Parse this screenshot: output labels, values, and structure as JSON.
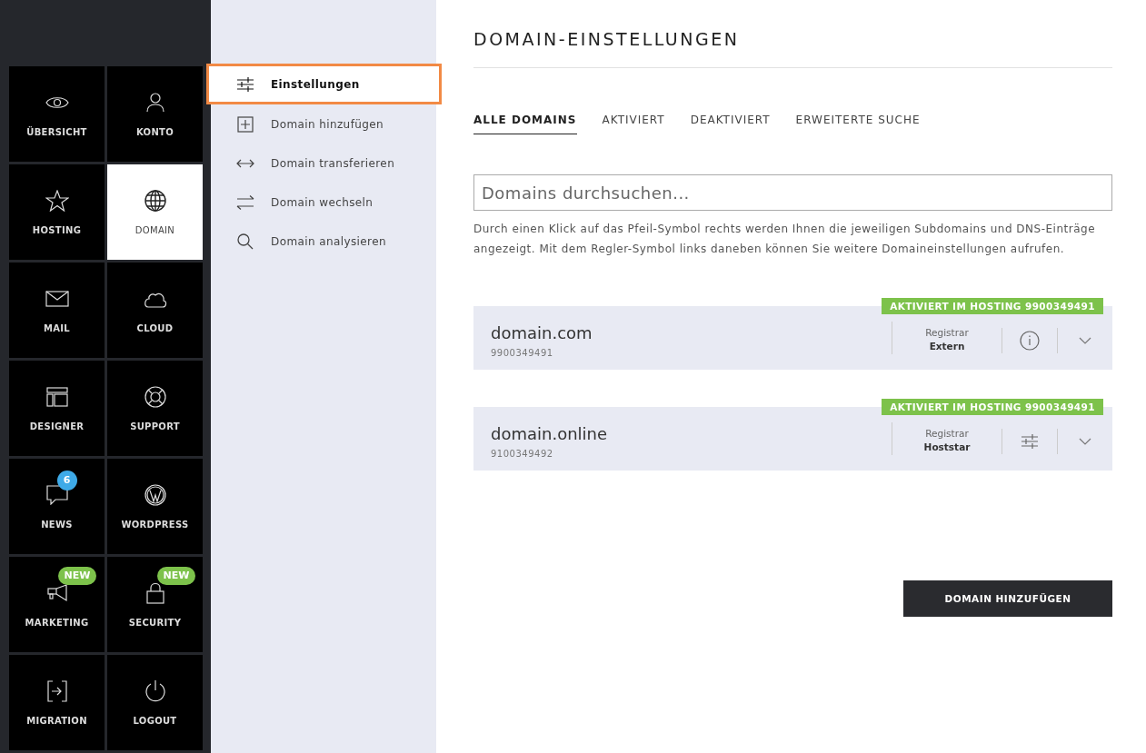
{
  "nav_tiles": [
    {
      "label": "ÜBERSICHT",
      "kind": "eye",
      "selected": false
    },
    {
      "label": "KONTO",
      "kind": "person",
      "selected": false
    },
    {
      "label": "HOSTING",
      "kind": "star",
      "selected": false
    },
    {
      "label": "DOMAIN",
      "kind": "globe",
      "selected": true
    },
    {
      "label": "MAIL",
      "kind": "mail",
      "selected": false
    },
    {
      "label": "CLOUD",
      "kind": "cloud",
      "selected": false
    },
    {
      "label": "DESIGNER",
      "kind": "layout",
      "selected": false
    },
    {
      "label": "SUPPORT",
      "kind": "lifebuoy",
      "selected": false
    },
    {
      "label": "NEWS",
      "kind": "chat",
      "selected": false,
      "badge": {
        "kind": "count",
        "text": "6"
      }
    },
    {
      "label": "WORDPRESS",
      "kind": "wordpress",
      "selected": false
    },
    {
      "label": "MARKETING",
      "kind": "megaphone",
      "selected": false,
      "badge": {
        "kind": "new",
        "text": "NEW"
      }
    },
    {
      "label": "SECURITY",
      "kind": "lock",
      "selected": false,
      "badge": {
        "kind": "new",
        "text": "NEW"
      }
    },
    {
      "label": "MIGRATION",
      "kind": "migration",
      "selected": false
    },
    {
      "label": "LOGOUT",
      "kind": "power",
      "selected": false
    }
  ],
  "submenu": [
    {
      "label": "Einstellungen",
      "kind": "sliders",
      "selected": true
    },
    {
      "label": "Domain hinzufügen",
      "kind": "plus",
      "selected": false
    },
    {
      "label": "Domain transferieren",
      "kind": "arrows",
      "selected": false
    },
    {
      "label": "Domain wechseln",
      "kind": "swap",
      "selected": false
    },
    {
      "label": "Domain analysieren",
      "kind": "search",
      "selected": false
    }
  ],
  "page_title": "DOMAIN-EINSTELLUNGEN",
  "tabs": [
    {
      "label": "ALLE DOMAINS",
      "selected": true
    },
    {
      "label": "AKTIVIERT",
      "selected": false
    },
    {
      "label": "DEAKTIVIERT",
      "selected": false
    },
    {
      "label": "ERWEITERTE SUCHE",
      "selected": false
    }
  ],
  "search": {
    "placeholder": "Domains durchsuchen..."
  },
  "hint": "Durch einen Klick auf das Pfeil-Symbol rechts werden Ihnen die jeweiligen Subdomains und DNS-Einträge angezeigt. Mit dem Regler-Symbol links daneben können Sie weitere Domaineinstellungen aufrufen.",
  "domains": [
    {
      "name": "domain.com",
      "number": "9900349491",
      "status": "AKTIVIERT IM HOSTING 9900349491",
      "registrar_label": "Registrar",
      "registrar": "Extern",
      "kind": "info"
    },
    {
      "name": "domain.online",
      "number": "9100349492",
      "status": "AKTIVIERT IM HOSTING 9900349491",
      "registrar_label": "Registrar",
      "registrar": "Hoststar",
      "kind": "settings"
    }
  ],
  "add_button": "DOMAIN HINZUFÜGEN"
}
